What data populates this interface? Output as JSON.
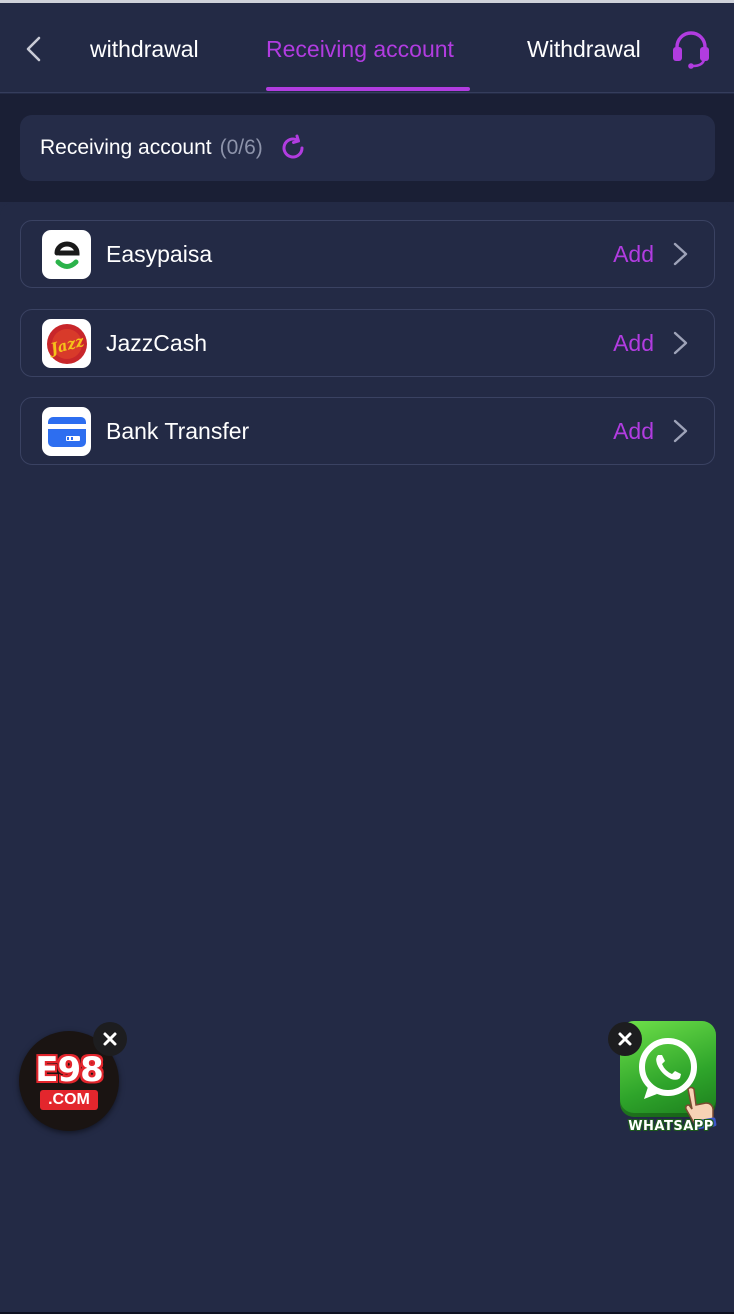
{
  "header": {
    "tabs": [
      {
        "label": "withdrawal"
      },
      {
        "label": "Receiving account"
      },
      {
        "label": "Withdrawal"
      }
    ],
    "active_tab_index": 1
  },
  "summary": {
    "label": "Receiving account",
    "count": "(0/6)"
  },
  "methods": [
    {
      "name": "Easypaisa",
      "action": "Add",
      "icon": "easypaisa-logo"
    },
    {
      "name": "JazzCash",
      "action": "Add",
      "icon": "jazzcash-logo"
    },
    {
      "name": "Bank Transfer",
      "action": "Add",
      "icon": "bank-card-icon"
    }
  ],
  "floating": {
    "e98_badge": {
      "text": "E98",
      "subtext": ".COM"
    },
    "whatsapp": {
      "label": "WHATSAPP"
    }
  },
  "colors": {
    "accent": "#b13ce0",
    "background": "#232a45",
    "card_border": "#3a4262"
  }
}
